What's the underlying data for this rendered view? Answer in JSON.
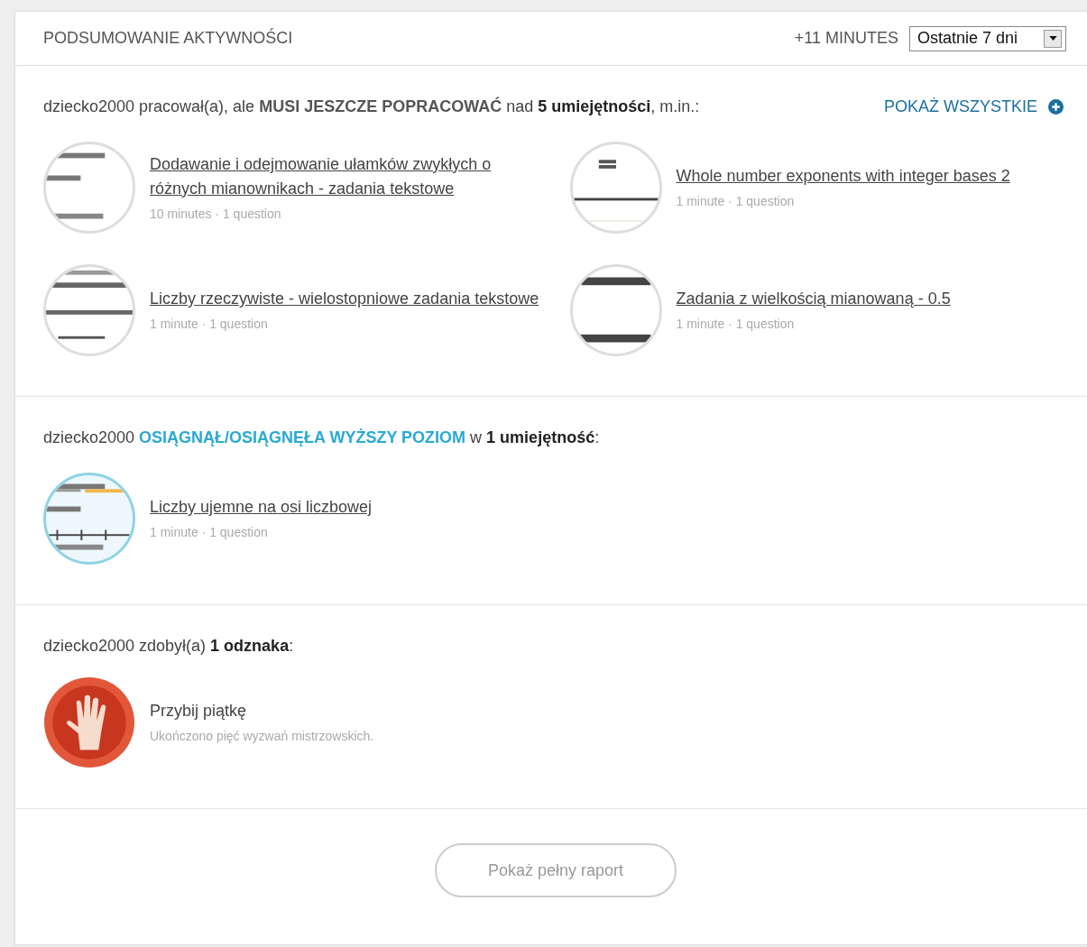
{
  "header": {
    "title": "PODSUMOWANIE AKTYWNOŚCI",
    "minutes": "+11 MINUTES",
    "range": {
      "value": "Ostatnie 7 dni"
    }
  },
  "sections": [
    {
      "kind": "skills",
      "sentence": [
        {
          "kind": "plain",
          "text": "dziecko2000 pracował(a), ale "
        },
        {
          "kind": "strong",
          "text": "MUSI JESZCZE POPRACOWAĆ"
        },
        {
          "kind": "plain",
          "text": " nad "
        },
        {
          "kind": "bold",
          "text": "5 umiejętności"
        },
        {
          "kind": "plain",
          "text": ", m.in.:"
        }
      ],
      "link": "POKAŻ WSZYSTKIE",
      "outlined": false,
      "items": [
        {
          "title": "Dodawanie i odejmowanie ułamków zwykłych o różnych mianownikach - zadania tekstowe",
          "meta": "10 minutes · 1 question",
          "kind": "picture"
        },
        {
          "title": "Whole number exponents with integer bases 2",
          "meta": "1 minute · 1 question",
          "kind": "picture"
        },
        {
          "title": "Liczby rzeczywiste - wielostopniowe zadania tekstowe",
          "meta": "1 minute · 1 question",
          "kind": "picture"
        },
        {
          "title": "Zadania z wielkością mianowaną - 0.5",
          "meta": "1 minute · 1 question",
          "kind": "picture"
        }
      ]
    },
    {
      "kind": "skills",
      "sentence": [
        {
          "kind": "plain",
          "text": "dziecko2000 "
        },
        {
          "kind": "highlight",
          "text": "OSIĄGNĄŁ/OSIĄGNĘŁA WYŻSZY POZIOM"
        },
        {
          "kind": "plain",
          "text": " w "
        },
        {
          "kind": "bold",
          "text": "1 umiejętność"
        },
        {
          "kind": "plain",
          "text": ":"
        }
      ],
      "outlined": true,
      "items": [
        {
          "title": "Liczby ujemne na osi liczbowej",
          "meta": "1 minute · 1 question",
          "kind": "picture"
        }
      ]
    },
    {
      "kind": "badges",
      "sentence": [
        {
          "kind": "plain",
          "text": "dziecko2000 zdobył(a) "
        },
        {
          "kind": "bold",
          "text": "1 odznaka"
        },
        {
          "kind": "plain",
          "text": ":"
        }
      ],
      "items": [
        {
          "title": "Przybij piątkę",
          "meta": "Ukończono pięć wyzwań mistrzowskich."
        }
      ]
    }
  ],
  "footer": {
    "button": "Pokaż pełny raport"
  }
}
